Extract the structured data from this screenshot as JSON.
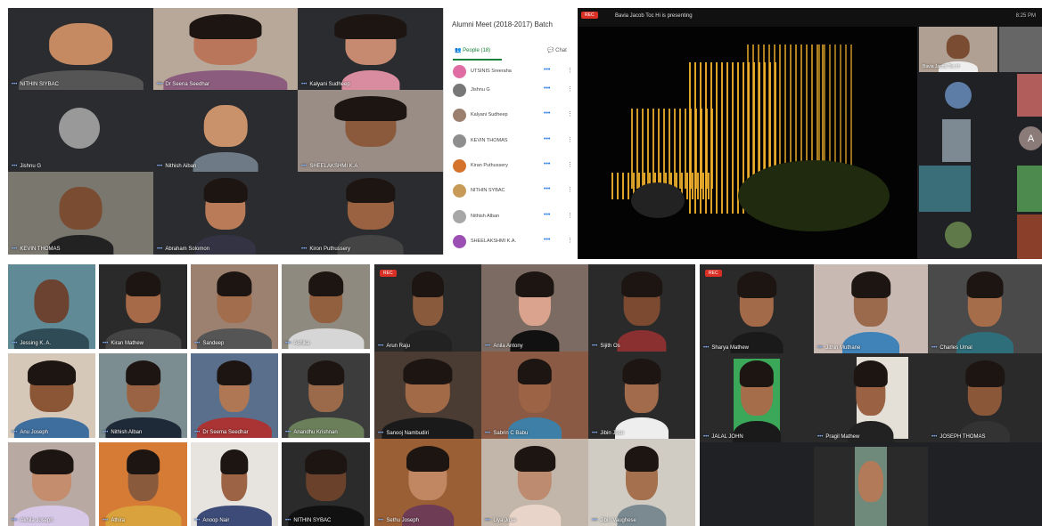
{
  "panel1": {
    "names": [
      "NITHIN SIYBAC",
      "Dr Seena Seedhar",
      "Kalyani Sudheep",
      "Jishnu G",
      "Nithish Aiban",
      "SHEELAKSHMI K.A",
      "KEVIN THOMAS",
      "Abraham Solomon",
      "Kiron Puthussery"
    ]
  },
  "people_panel": {
    "title": "Alumni Meet (2018-2017) Batch",
    "tab_people": "People (18)",
    "tab_chat": "Chat",
    "rows": [
      "UTSINIS Sreeraha",
      "Jishnu G",
      "Kalyani Sudheep",
      "KEVIN THOMAS",
      "Kiran Puthussery",
      "NITHIN SYBAC",
      "Nithish Alban",
      "SHEELAKSHMI K.A."
    ]
  },
  "presenting": {
    "label": "Bavia Jacob Toc Hi is presenting",
    "time": "8:25 PM",
    "sideName": "Bavia Jacob Toc H",
    "avatarLetter": "A"
  },
  "rec": "REC",
  "panel3": {
    "names": [
      "Jessing K. A.",
      "Kiran Mathew",
      "Sandeep",
      "Ashika",
      "Anu Joseph",
      "Nithish Alban",
      "Dr Seema Seedhar",
      "Anandhu Krishnan",
      "Akhila Joseph",
      "Athira",
      "Anoop Nair",
      "NITHIN SYBAC"
    ]
  },
  "panel4": {
    "names": [
      "Arun Raju",
      "Anila Antony",
      "Sijith Os",
      "Sanooj Nambudiri",
      "Sabrin C Babu",
      "Jibin Jose",
      "Sethu Joseph",
      "Liya Jose",
      "Jibin Vaughese"
    ]
  },
  "panel5": {
    "names": [
      "Sharya Mathew",
      "Jithin Muthane",
      "Charles Umal",
      "JALAL JOHN",
      "Pragil Mathew",
      "JOSEPH THOMAS"
    ]
  }
}
